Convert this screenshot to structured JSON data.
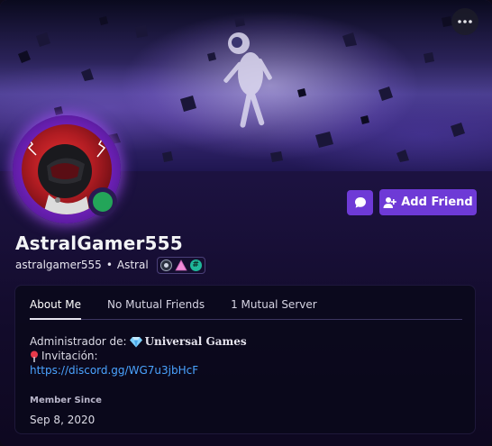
{
  "profile": {
    "display_name": "AstralGamer555",
    "username": "astralgamer555",
    "separator": "•",
    "tag": "Astral",
    "status": "online",
    "status_color": "#23a559"
  },
  "actions": {
    "message_icon": "chat-bubble-icon",
    "add_friend_label": "Add Friend",
    "more_icon": "more-dots-icon"
  },
  "badges": [
    "moon-icon",
    "triangle-icon",
    "hash-icon"
  ],
  "tabs": [
    {
      "label": "About Me",
      "active": true
    },
    {
      "label": "No Mutual Friends",
      "active": false
    },
    {
      "label": "1 Mutual Server",
      "active": false
    }
  ],
  "about": {
    "admin_prefix": "Administrador de:",
    "server_name": "𝐔𝐧𝐢𝐯𝐞𝐫𝐬𝐚𝐥 𝐆𝐚𝐦𝐞𝐬",
    "invite_label": "Invitación:",
    "invite_link": "https://discord.gg/WG7u3jbHcF"
  },
  "member_since": {
    "label": "Member Since",
    "value": "Sep 8, 2020"
  },
  "colors": {
    "accent": "#6e3ad6",
    "link": "#4aa3ff",
    "avatar_ring": "#8a2bd6"
  }
}
